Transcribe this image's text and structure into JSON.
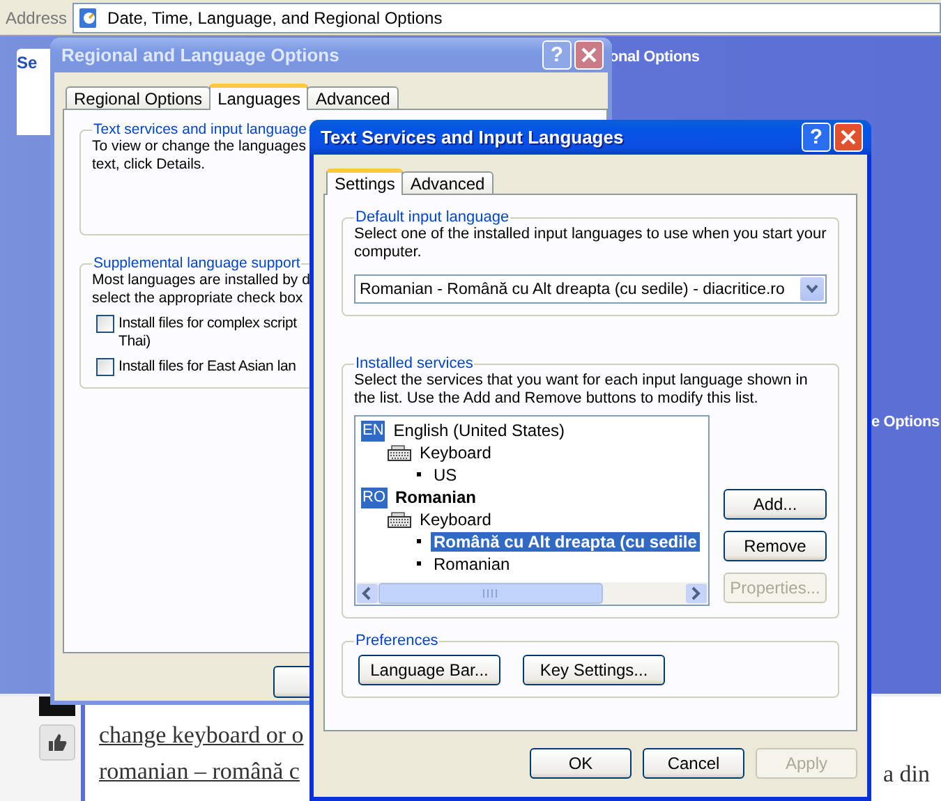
{
  "address_bar": {
    "label": "Address",
    "value": "Date, Time, Language, and Regional Options"
  },
  "background": {
    "side_heading": "Se",
    "headings": [
      "onal Options",
      "e Options"
    ]
  },
  "web_page": {
    "lines": [
      "change keyboard or o",
      "romanian – română c"
    ],
    "right_fragment": "a din"
  },
  "regional_window": {
    "title": "Regional and Language Options",
    "active": false,
    "title_buttons": [
      "?"
    ],
    "tabs": [
      {
        "label": "Regional Options",
        "selected": false
      },
      {
        "label": "Languages",
        "selected": true
      },
      {
        "label": "Advanced",
        "selected": false
      }
    ],
    "groups": [
      {
        "legend": "Text services and input language",
        "lines": [
          "To view or change the languages",
          "text, click Details."
        ]
      },
      {
        "legend": "Supplemental language support",
        "lines": [
          "Most languages are installed by d",
          "select the appropriate check box"
        ],
        "checkboxes": [
          {
            "lines": [
              "Install files for complex script",
              "Thai)"
            ],
            "checked": false
          },
          {
            "lines": [
              "Install files for East Asian lan"
            ],
            "checked": false
          }
        ]
      }
    ]
  },
  "text_services_window": {
    "title": "Text Services and Input Languages",
    "active": true,
    "title_buttons": [
      "?"
    ],
    "tabs": [
      {
        "label": "Settings",
        "selected": true
      },
      {
        "label": "Advanced",
        "selected": false
      }
    ],
    "default_language": {
      "legend": "Default input language",
      "text": "Select one of the installed input languages to use when you start your computer.",
      "value": "Romanian - Română cu Alt dreapta (cu sedile) - diacritice.ro"
    },
    "installed_services": {
      "legend": "Installed services",
      "text": "Select the services that you want for each input language shown in the list. Use the Add and Remove buttons to modify this list.",
      "tree": [
        {
          "kind": "language",
          "badge": "EN",
          "label": "English (United States)",
          "default": false,
          "selected": false,
          "children": [
            {
              "kind": "category",
              "label": "Keyboard",
              "default": false,
              "selected": false,
              "children": [
                {
                  "kind": "layout",
                  "label": "US",
                  "default": false,
                  "selected": false
                }
              ]
            }
          ]
        },
        {
          "kind": "language",
          "badge": "RO",
          "label": "Romanian",
          "default": true,
          "selected": false,
          "children": [
            {
              "kind": "category",
              "label": "Keyboard",
              "default": false,
              "selected": false,
              "children": [
                {
                  "kind": "layout",
                  "label": "Română cu Alt dreapta (cu sedile",
                  "default": true,
                  "selected": true
                },
                {
                  "kind": "layout",
                  "label": "Romanian",
                  "default": false,
                  "selected": false
                }
              ]
            }
          ]
        }
      ],
      "buttons": [
        {
          "label": "Add...",
          "disabled": false
        },
        {
          "label": "Remove",
          "disabled": false
        },
        {
          "label": "Properties...",
          "disabled": true
        }
      ]
    },
    "preferences": {
      "legend": "Preferences",
      "buttons": [
        {
          "label": "Language Bar...",
          "disabled": false
        },
        {
          "label": "Key Settings...",
          "disabled": false
        }
      ]
    },
    "buttons": [
      {
        "label": "OK",
        "disabled": false
      },
      {
        "label": "Cancel",
        "disabled": false
      },
      {
        "label": "Apply",
        "disabled": true
      }
    ]
  }
}
